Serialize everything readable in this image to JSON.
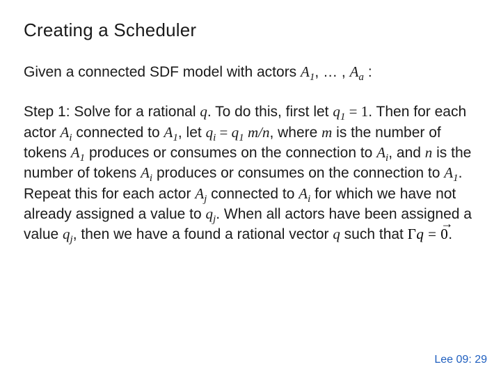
{
  "title": "Creating a Scheduler",
  "intro": {
    "lead": "Given a connected SDF model with actors ",
    "series_start": "A",
    "sub1": "1",
    "sep": ", … , ",
    "series_end": "A",
    "sub_a": "a",
    "tail": " :"
  },
  "body": {
    "t1": "Step 1: Solve for a rational ",
    "q": "q",
    "t2": ". To do this, first let ",
    "q1": "q",
    "q1_sub": "1",
    "eq1": " = ",
    "one": "1",
    "t3": ". Then for each actor ",
    "Ai": "A",
    "i": "i",
    "t4": " connected to ",
    "A1": "A",
    "sub1b": "1",
    "t5": ", let ",
    "qi": "q",
    "eq2": " = ",
    "q1b": "q",
    "sub1c": "1",
    "mn": " m/n",
    "t6": ", where ",
    "m": "m",
    "t7": " is the number of tokens ",
    "A1c": "A",
    "sub1d": "1",
    "t8": " produces or consumes on the connection to ",
    "Ai2": "A",
    "i2": "i",
    "t9": ", and ",
    "n": "n",
    "t10": " is the number of tokens ",
    "Ai3": "A",
    "i3": "i",
    "t11": " produces or consumes on the connection to ",
    "A1d": "A",
    "sub1e": "1",
    "t12": ". Repeat this for each actor ",
    "Aj": "A",
    "j": "j",
    "t13": " connected to ",
    "Ai4": "A",
    "i4": "i",
    "t14": " for which we have not already assigned a value to  ",
    "qj": "q",
    "jsub": "j",
    "t15": ". When all actors have been assigned a value ",
    "qj2": "q",
    "jsub2": "j",
    "t16": ", then we have a found a rational vector ",
    "qv": "q",
    "t17": " such that ",
    "eq_gamma": "Γ",
    "eq_q": "q",
    "eq_eq": " = ",
    "eq_zero": "0",
    "period": "."
  },
  "footer": "Lee 09: 29"
}
